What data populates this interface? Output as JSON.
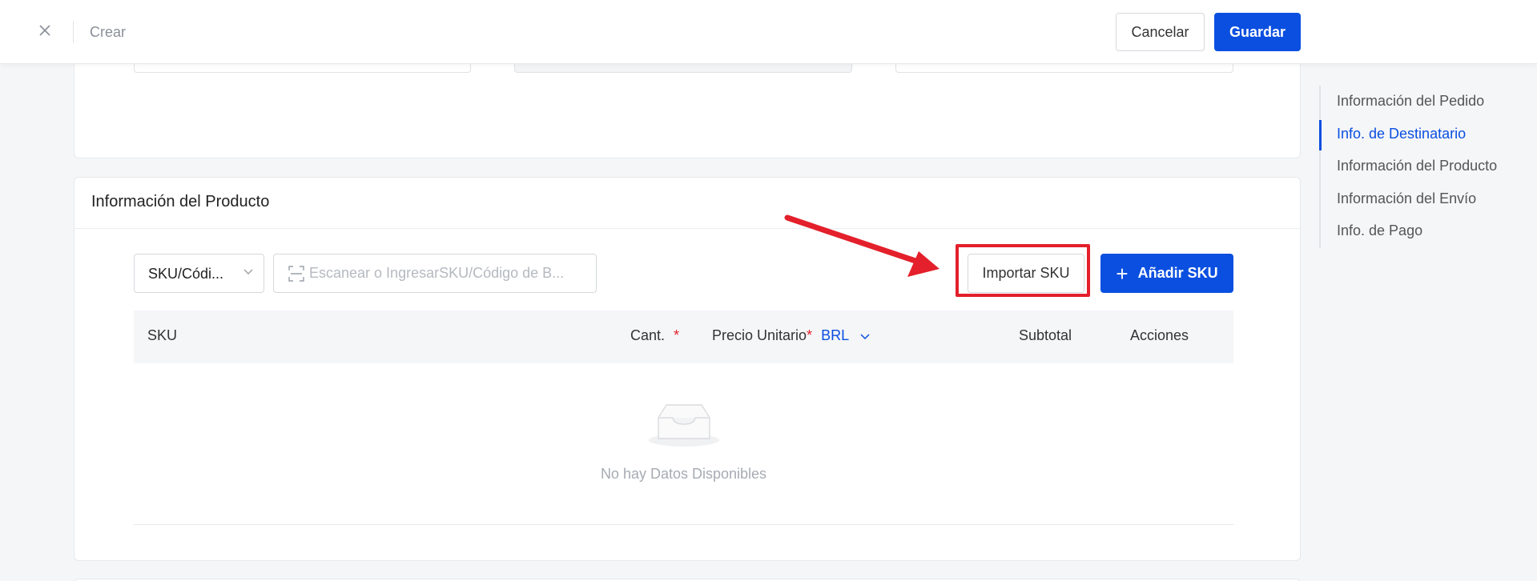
{
  "header": {
    "title": "Crear",
    "cancel_label": "Cancelar",
    "save_label": "Guardar"
  },
  "product_section": {
    "title": "Información del Producto",
    "search_type": "SKU/Códi...",
    "search_placeholder": "Escanear o IngresarSKU/Código de B...",
    "import_label": "Importar SKU",
    "add_label": "Añadir SKU",
    "table": {
      "columns": {
        "sku": "SKU",
        "qty": "Cant.",
        "unit_price": "Precio Unitario",
        "currency": "BRL",
        "subtotal": "Subtotal",
        "actions": "Acciones"
      },
      "required_mark": "*",
      "empty_text": "No hay Datos Disponibles"
    }
  },
  "anchor_nav": {
    "items": [
      {
        "label": "Información del Pedido",
        "active": false
      },
      {
        "label": "Info. de Destinatario",
        "active": true
      },
      {
        "label": "Información del Producto",
        "active": false
      },
      {
        "label": "Información del Envío",
        "active": false
      },
      {
        "label": "Info. de Pago",
        "active": false
      }
    ]
  },
  "colors": {
    "primary": "#0a4fe0",
    "annotation": "#e3202b"
  }
}
